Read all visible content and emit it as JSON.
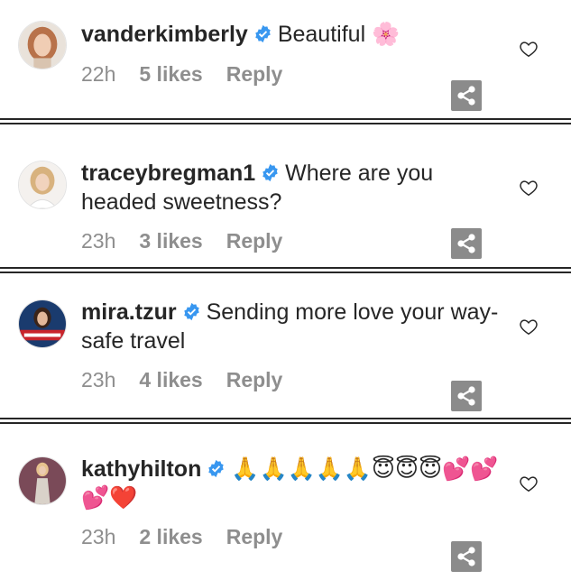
{
  "comments": [
    {
      "username": "vanderkimberly",
      "text": "Beautiful",
      "emoji": "🌸",
      "time": "22h",
      "likes": "5 likes",
      "reply": "Reply"
    },
    {
      "username": "traceybregman1",
      "text": "Where are you headed sweetness?",
      "emoji": "",
      "time": "23h",
      "likes": "3 likes",
      "reply": "Reply"
    },
    {
      "username": "mira.tzur",
      "text": "Sending more love your way-safe travel",
      "emoji": "",
      "time": "23h",
      "likes": "4 likes",
      "reply": "Reply"
    },
    {
      "username": "kathyhilton",
      "text": "",
      "emoji": "🙏🙏🙏🙏🙏😇😇😇💕💕💕❤️",
      "time": "23h",
      "likes": "2 likes",
      "reply": "Reply"
    }
  ],
  "icons": {
    "verified": "verified-badge-icon",
    "like": "heart-outline-icon",
    "share": "share-icon"
  },
  "colors": {
    "verified_blue": "#3897f0",
    "meta_gray": "#8e8e8e",
    "share_gray": "#8b8b8b"
  }
}
